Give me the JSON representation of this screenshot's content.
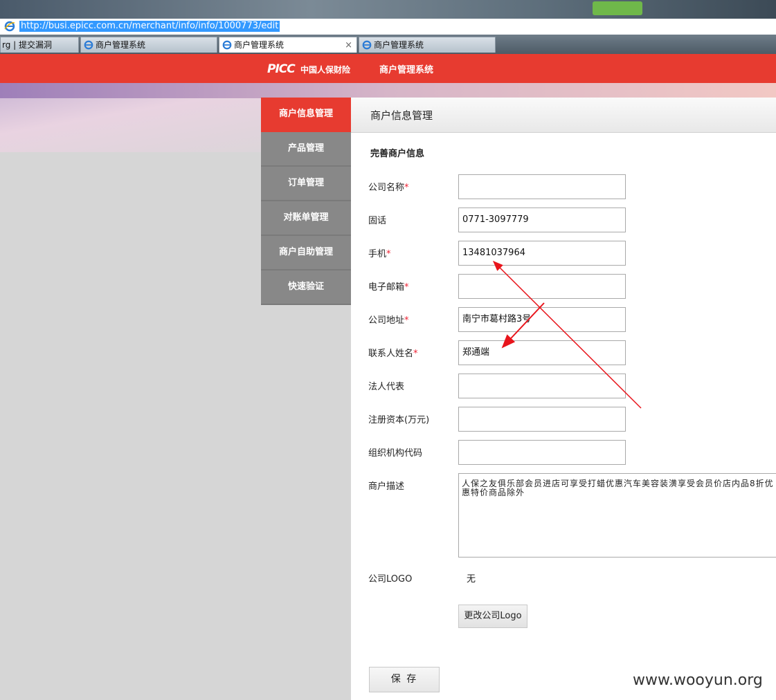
{
  "browser": {
    "url": "http://busi.epicc.com.cn/merchant/info/info/1000773/edit",
    "tabs": [
      {
        "label": "rg | 提交漏洞"
      },
      {
        "label": "商户管理系统"
      },
      {
        "label": "商户管理系统",
        "close": "×"
      },
      {
        "label": "商户管理系统"
      }
    ]
  },
  "header": {
    "logo_mark": "PICC",
    "logo_cn": "中国人保财险",
    "system_title": "商户管理系统"
  },
  "sidebar": {
    "items": [
      {
        "label": "商户信息管理"
      },
      {
        "label": "产品管理"
      },
      {
        "label": "订单管理"
      },
      {
        "label": "对账单管理"
      },
      {
        "label": "商户自助管理"
      },
      {
        "label": "快速验证"
      }
    ]
  },
  "main": {
    "title": "商户信息管理",
    "section_title": "完善商户信息",
    "required_mark": "*",
    "fields": [
      {
        "label": "公司名称",
        "required": true,
        "value": ""
      },
      {
        "label": "固话",
        "required": false,
        "value": "0771-3097779"
      },
      {
        "label": "手机",
        "required": true,
        "value": "13481037964"
      },
      {
        "label": "电子邮箱",
        "required": true,
        "value": ""
      },
      {
        "label": "公司地址",
        "required": true,
        "value": "南宁市葛村路3号"
      },
      {
        "label": "联系人姓名",
        "required": true,
        "value": "郑通端"
      },
      {
        "label": "法人代表",
        "required": false,
        "value": ""
      },
      {
        "label": "注册资本(万元)",
        "required": false,
        "value": ""
      },
      {
        "label": "组织机构代码",
        "required": false,
        "value": ""
      }
    ],
    "description_label": "商户描述",
    "description_value": "人保之友俱乐部会员进店可享受打蜡优惠汽车美容装潢享受会员价店内品8折优惠特价商品除外",
    "logo_label": "公司LOGO",
    "logo_value": "无",
    "change_logo_button": "更改公司Logo",
    "save_button": "保 存"
  },
  "watermark": "www.wooyun.org",
  "colors": {
    "brand_red": "#e73b30",
    "sidebar_gray": "#888888",
    "annotation_arrow": "#e8141b"
  }
}
